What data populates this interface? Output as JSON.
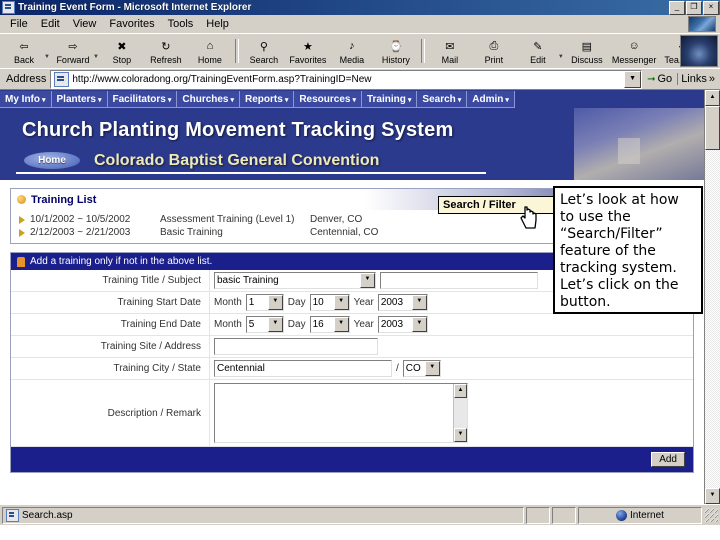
{
  "window": {
    "title": "Training Event Form - Microsoft Internet Explorer",
    "minimize": "_",
    "maximize": "❐",
    "close": "×"
  },
  "menu": {
    "items": [
      {
        "label": "File"
      },
      {
        "label": "Edit"
      },
      {
        "label": "View"
      },
      {
        "label": "Favorites"
      },
      {
        "label": "Tools"
      },
      {
        "label": "Help"
      }
    ]
  },
  "toolbar": {
    "buttons": [
      {
        "label": "Back",
        "icon": "back-arrow-icon",
        "glyph": "⇦",
        "dropdown": true
      },
      {
        "label": "Forward",
        "icon": "forward-arrow-icon",
        "glyph": "⇨",
        "dropdown": true
      },
      {
        "label": "Stop",
        "icon": "stop-icon",
        "glyph": "✖",
        "dropdown": false
      },
      {
        "label": "Refresh",
        "icon": "refresh-icon",
        "glyph": "↻",
        "dropdown": false
      },
      {
        "label": "Home",
        "icon": "home-icon",
        "glyph": "⌂",
        "dropdown": false
      },
      {
        "label": "Search",
        "icon": "search-icon",
        "glyph": "⚲",
        "dropdown": false
      },
      {
        "label": "Favorites",
        "icon": "favorites-icon",
        "glyph": "★",
        "dropdown": false
      },
      {
        "label": "Media",
        "icon": "media-icon",
        "glyph": "♪",
        "dropdown": false
      },
      {
        "label": "History",
        "icon": "history-icon",
        "glyph": "⌚",
        "dropdown": false
      },
      {
        "label": "Mail",
        "icon": "mail-icon",
        "glyph": "✉",
        "dropdown": true
      },
      {
        "label": "Print",
        "icon": "print-icon",
        "glyph": "⎙",
        "dropdown": false
      },
      {
        "label": "Edit",
        "icon": "edit-icon",
        "glyph": "✎",
        "dropdown": true
      },
      {
        "label": "Discuss",
        "icon": "discuss-icon",
        "glyph": "▤",
        "dropdown": false
      },
      {
        "label": "Messenger",
        "icon": "messenger-icon",
        "glyph": "☺",
        "dropdown": false
      },
      {
        "label": "Tea.com",
        "icon": "tea-icon",
        "glyph": "◕",
        "dropdown": false
      }
    ]
  },
  "address": {
    "label": "Address",
    "url": "http://www.coloradong.org/TrainingEventForm.asp?TrainingID=New",
    "go_label": "Go",
    "links_label": "Links",
    "links_chevron": "»",
    "dropdown_glyph": "▼"
  },
  "site_nav": {
    "items": [
      {
        "label": "My Info"
      },
      {
        "label": "Planters"
      },
      {
        "label": "Facilitators"
      },
      {
        "label": "Churches"
      },
      {
        "label": "Reports"
      },
      {
        "label": "Resources"
      },
      {
        "label": "Training"
      },
      {
        "label": "Search"
      },
      {
        "label": "Admin"
      }
    ],
    "caret": "▾"
  },
  "dropdown_menu": {
    "item": "Search / Filter"
  },
  "banner": {
    "title": "Church Planting Movement Tracking System",
    "home_button": "Home",
    "subtitle": "Colorado Baptist General Convention"
  },
  "training_list": {
    "panel_title": "Training List",
    "panel_tag": "Training",
    "rows": [
      {
        "dates": "10/1/2002 ~ 10/5/2002",
        "subject": "Assessment Training (Level 1)",
        "place": "Denver, CO"
      },
      {
        "dates": "2/12/2003 ~ 2/21/2003",
        "subject": "Basic Training",
        "place": "Centennial, CO"
      }
    ]
  },
  "add_form": {
    "header": "Add a training only if not in the above list.",
    "fields": {
      "title_label": "Training Title / Subject",
      "title_value": "basic Training",
      "title_extra_value": "",
      "start_label": "Training Start Date",
      "start_month_label": "Month",
      "start_month": "1",
      "start_day_label": "Day",
      "start_day": "10",
      "start_year_label": "Year",
      "start_year": "2003",
      "end_label": "Training End Date",
      "end_month_label": "Month",
      "end_month": "5",
      "end_day_label": "Day",
      "end_day": "16",
      "end_year_label": "Year",
      "end_year": "2003",
      "site_label": "Training Site / Address",
      "site_value": "",
      "city_label": "Training City / State",
      "city_value": "Centennial",
      "city_state_sep": "/",
      "state_value": "CO",
      "desc_label": "Description / Remark",
      "desc_value": ""
    },
    "add_button": "Add",
    "select_arrow": "▼"
  },
  "scrollbar": {
    "up": "▲",
    "down": "▼"
  },
  "statusbar": {
    "page": "Search.asp",
    "zone": "Internet"
  },
  "callout": {
    "text": "Let’s look at how to use the “Search/Filter” feature of the tracking system. Let’s click on the button."
  },
  "colors": {
    "chrome": "#d4d0c8",
    "title_blue": "#0a246a",
    "site_blue": "#2b3a8c",
    "panel_blue": "#1a1f8c",
    "dropdown_bg": "#fbf6d8",
    "banner_gold": "#efe9b8"
  }
}
